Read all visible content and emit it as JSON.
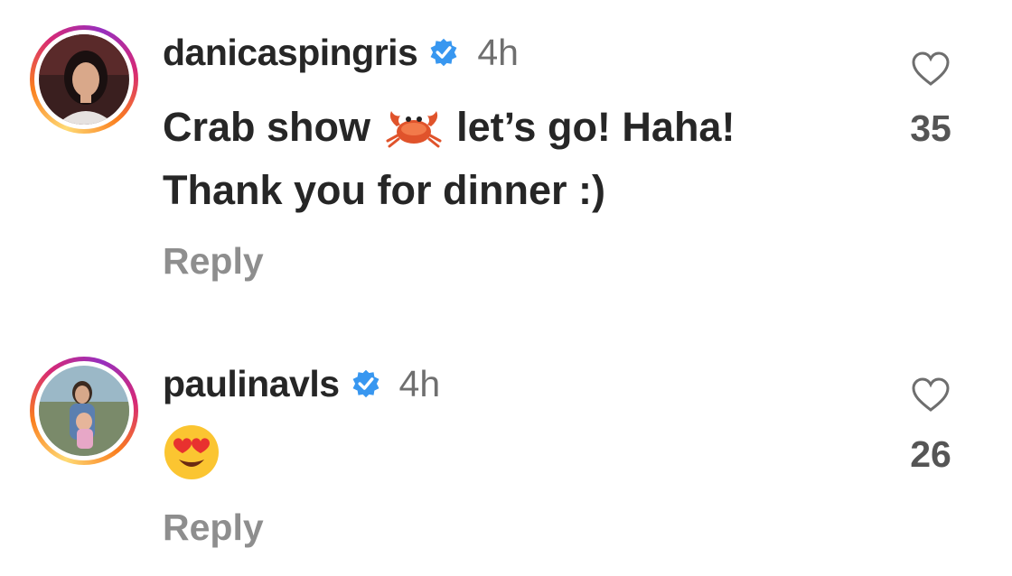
{
  "comments": [
    {
      "username": "danicaspingris",
      "time": "4h",
      "text_line1_before": "Crab show",
      "text_line1_after": "let’s go! Haha!",
      "text_line2": "Thank you for dinner :)",
      "emoji": "crab",
      "reply_label": "Reply",
      "likes": "35"
    },
    {
      "username": "paulinavls",
      "time": "4h",
      "emoji": "heart-eyes",
      "reply_label": "Reply",
      "likes": "26"
    }
  ],
  "colors": {
    "verified": "#3897f0",
    "text": "#262626",
    "secondary": "#8e8e8e"
  }
}
